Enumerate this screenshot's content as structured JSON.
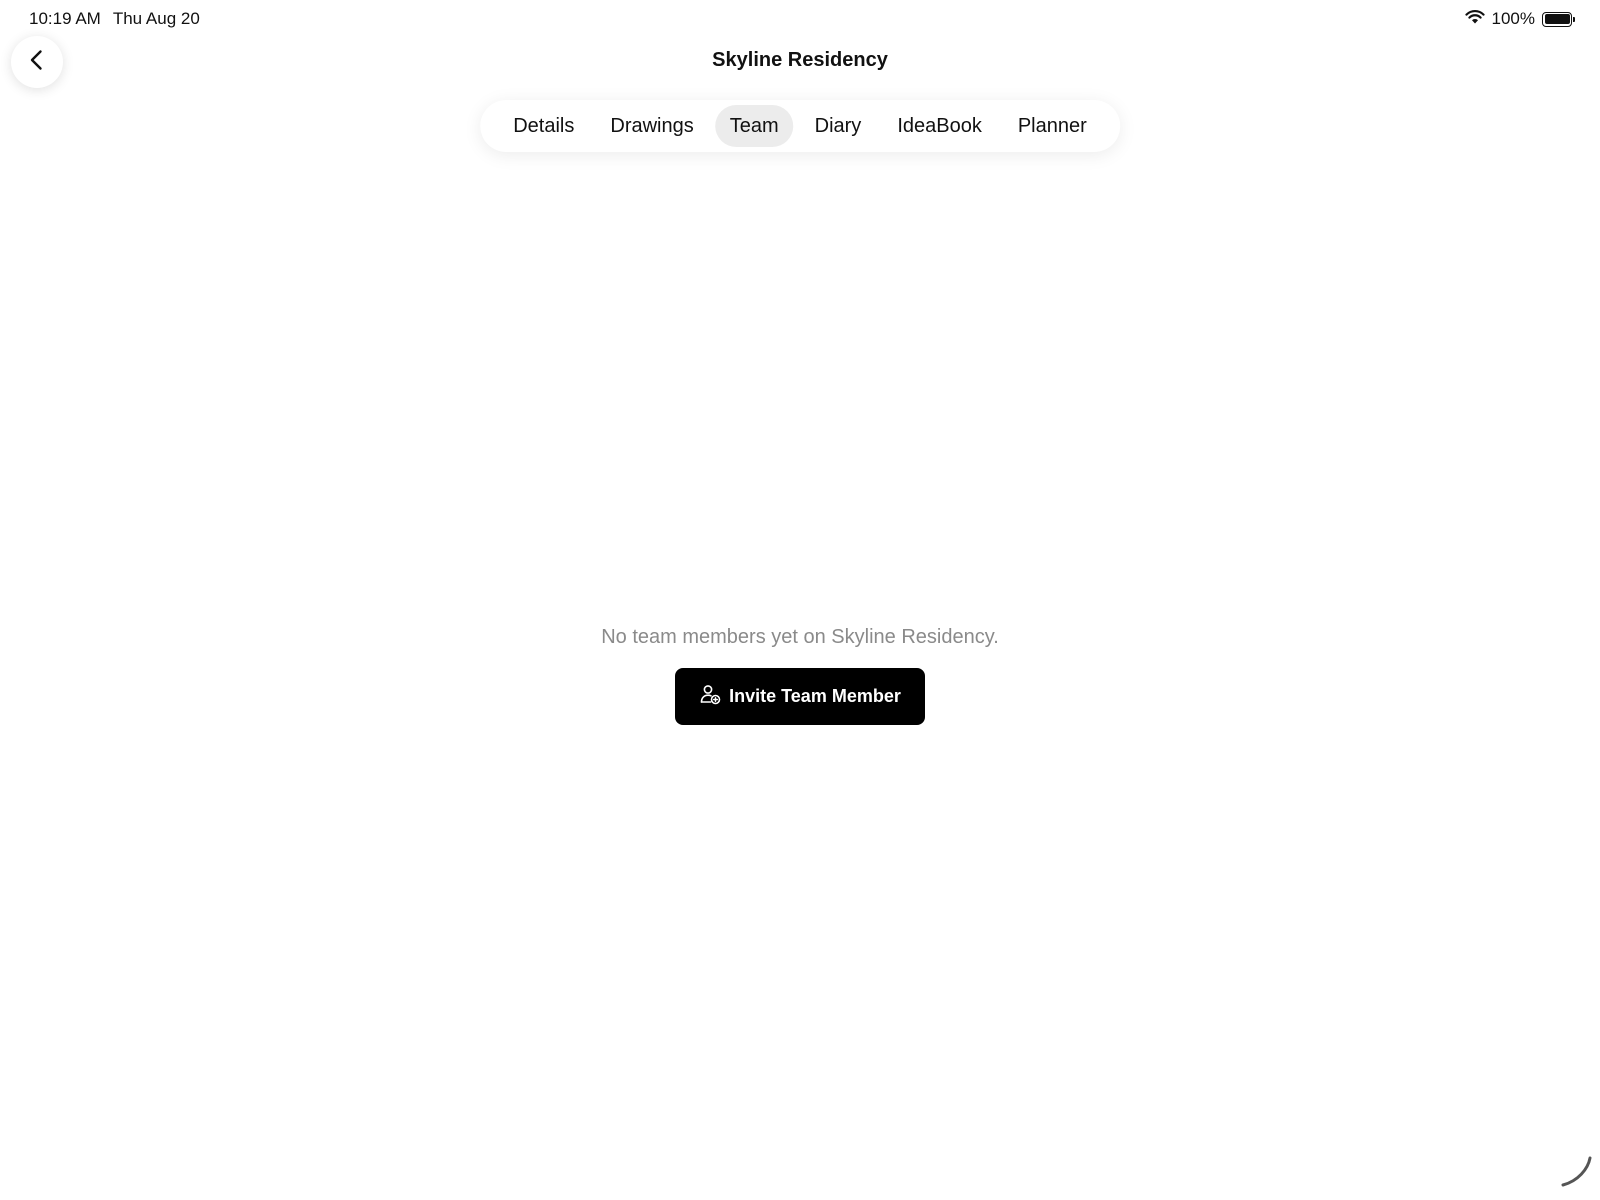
{
  "status_bar": {
    "time": "10:19 AM",
    "date": "Thu Aug 20",
    "battery_text": "100%",
    "battery_level": 1.0
  },
  "header": {
    "title": "Skyline Residency",
    "back_icon": "chevron-left-icon"
  },
  "tabs": [
    {
      "label": "Details",
      "active": false
    },
    {
      "label": "Drawings",
      "active": false
    },
    {
      "label": "Team",
      "active": true
    },
    {
      "label": "Diary",
      "active": false
    },
    {
      "label": "IdeaBook",
      "active": false
    },
    {
      "label": "Planner",
      "active": false
    }
  ],
  "empty_state": {
    "message": "No team members yet on Skyline Residency.",
    "button_label": "Invite Team Member",
    "button_icon": "user-plus-icon"
  },
  "colors": {
    "primary_button": "#000000",
    "active_tab_bg": "#ececec",
    "muted_text": "#8a8a8a"
  }
}
